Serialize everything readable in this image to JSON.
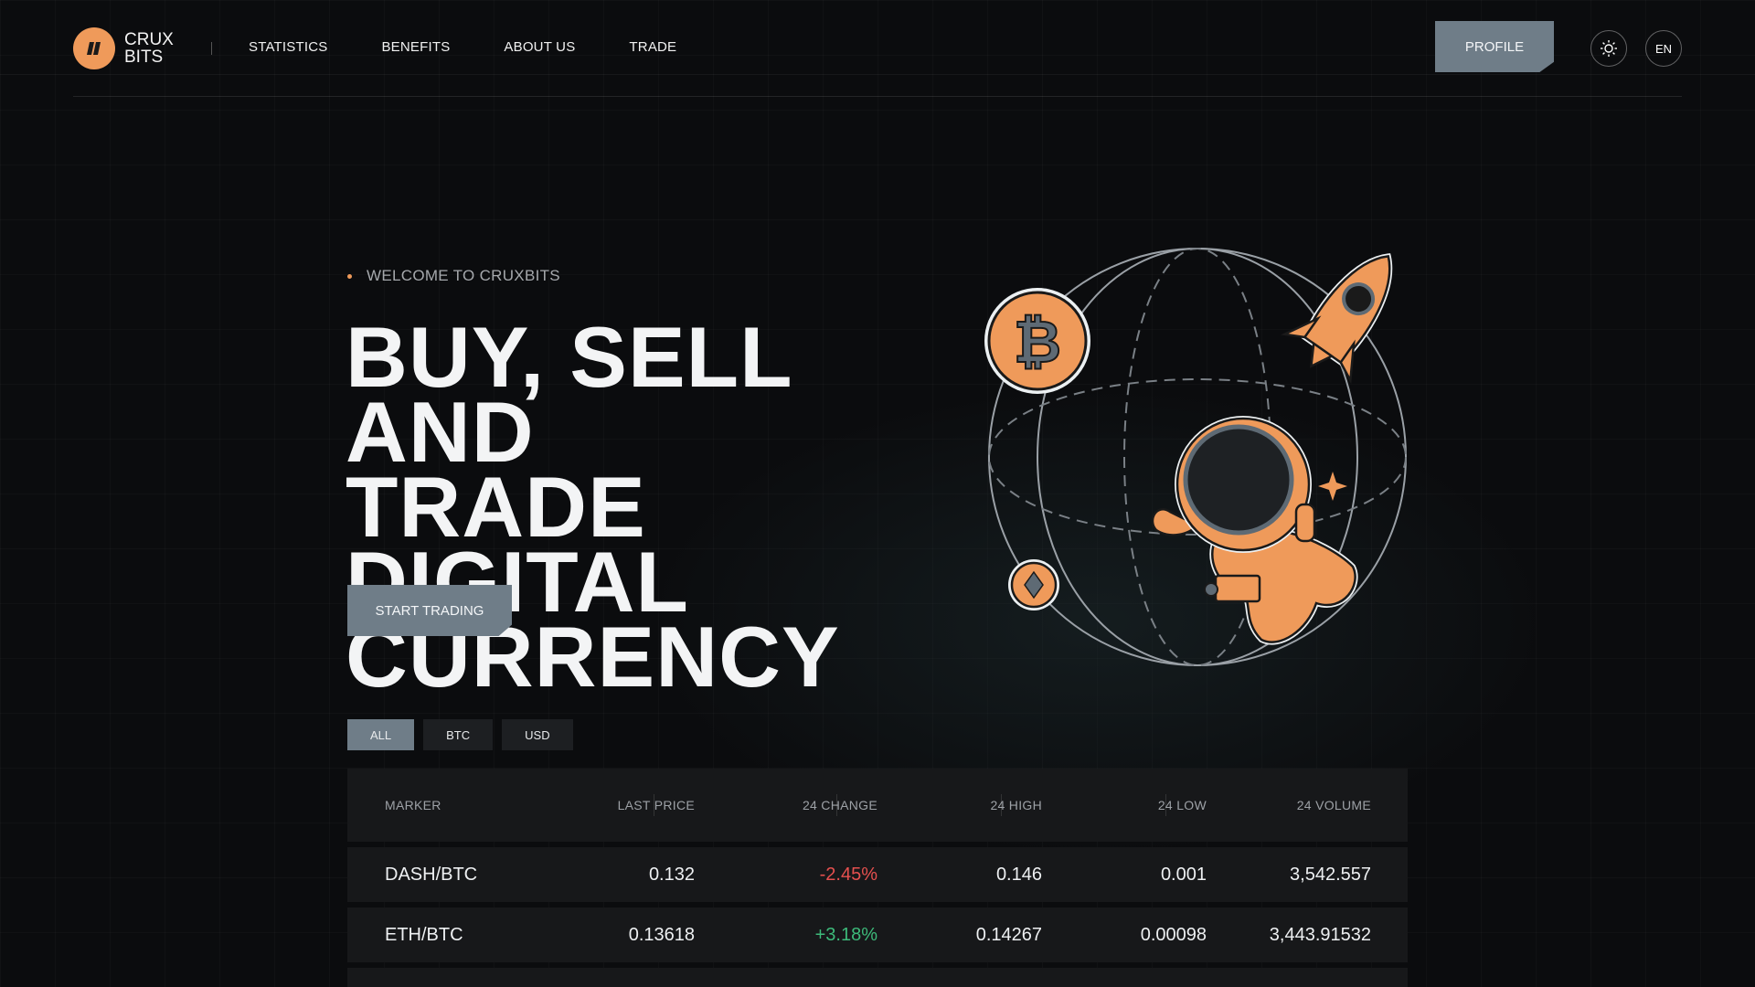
{
  "brand": {
    "line1": "CRUX",
    "line2": "BITS",
    "accent": "#ef9a5a"
  },
  "nav": {
    "items": [
      {
        "label": "STATISTICS"
      },
      {
        "label": "BENEFITS"
      },
      {
        "label": "ABOUT US"
      },
      {
        "label": "TRADE"
      }
    ]
  },
  "header": {
    "profile_label": "PROFILE",
    "theme_icon": "sun-icon",
    "language": "EN"
  },
  "hero": {
    "eyebrow": "WELCOME TO CRUXBITS",
    "title_lines": [
      "BUY, SELL AND",
      "TRADE DIGITAL",
      "CURRENCY"
    ],
    "cta_label": "START TRADING"
  },
  "filters": [
    {
      "label": "ALL",
      "active": true
    },
    {
      "label": "BTC",
      "active": false
    },
    {
      "label": "USD",
      "active": false
    }
  ],
  "table": {
    "columns": [
      "MARKER",
      "LAST PRICE",
      "24 CHANGE",
      "24 HIGH",
      "24 LOW",
      "24 VOLUME"
    ],
    "rows": [
      {
        "marker": "DASH/BTC",
        "last_price": "0.132",
        "change": "-2.45%",
        "high": "0.146",
        "low": "0.001",
        "volume": "3,542.557"
      },
      {
        "marker": "ETH/BTC",
        "last_price": "0.13618",
        "change": "+3.18%",
        "high": "0.14267",
        "low": "0.00098",
        "volume": "3,443.91532"
      }
    ]
  },
  "colors": {
    "button": "#6f7d88",
    "negative": "#e5504f",
    "positive": "#3dba7a",
    "background": "#0b0c0e"
  }
}
